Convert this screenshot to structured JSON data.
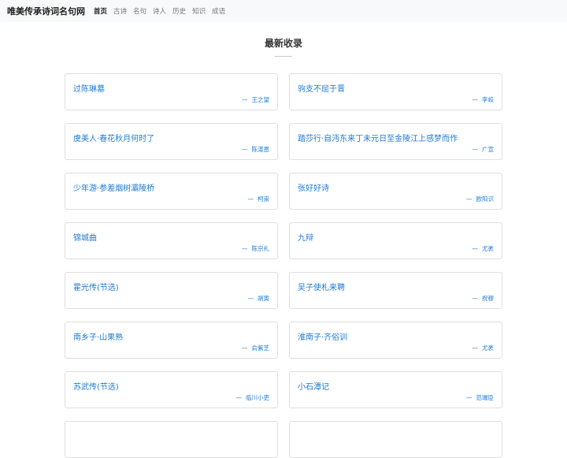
{
  "header": {
    "site_name": "唯美传承诗词名句网",
    "nav": [
      "首页",
      "古诗",
      "名句",
      "诗人",
      "历史",
      "知识",
      "成语"
    ]
  },
  "section": {
    "title": "最新收录"
  },
  "author_prefix": "—",
  "items": [
    {
      "title": "过陈琳墓",
      "author": "王之望"
    },
    {
      "title": "驹支不屈于晋",
      "author": "李峧"
    },
    {
      "title": "虞美人·春花秋月何时了",
      "author": "陈湛恩"
    },
    {
      "title": "踏莎行·自沔东来丁未元日至金陵江上感梦而作",
      "author": "广宣"
    },
    {
      "title": "少年游·参差烟树灞陵桥",
      "author": "柯崇"
    },
    {
      "title": "张好好诗",
      "author": "欧阳识"
    },
    {
      "title": "锦城曲",
      "author": "陈宗礼"
    },
    {
      "title": "九辩",
      "author": "尤袤"
    },
    {
      "title": "霍光传(节选)",
      "author": "胡寅"
    },
    {
      "title": "吴子使札来聘",
      "author": "祝穆"
    },
    {
      "title": "南乡子·山果熟",
      "author": "俞紫芝"
    },
    {
      "title": "淮南子·齐俗训",
      "author": "尤袤"
    },
    {
      "title": "苏武传(节选)",
      "author": "临川小吏"
    },
    {
      "title": "小石潭记",
      "author": "范端臣"
    },
    {
      "title": "",
      "author": ""
    },
    {
      "title": "",
      "author": ""
    }
  ]
}
